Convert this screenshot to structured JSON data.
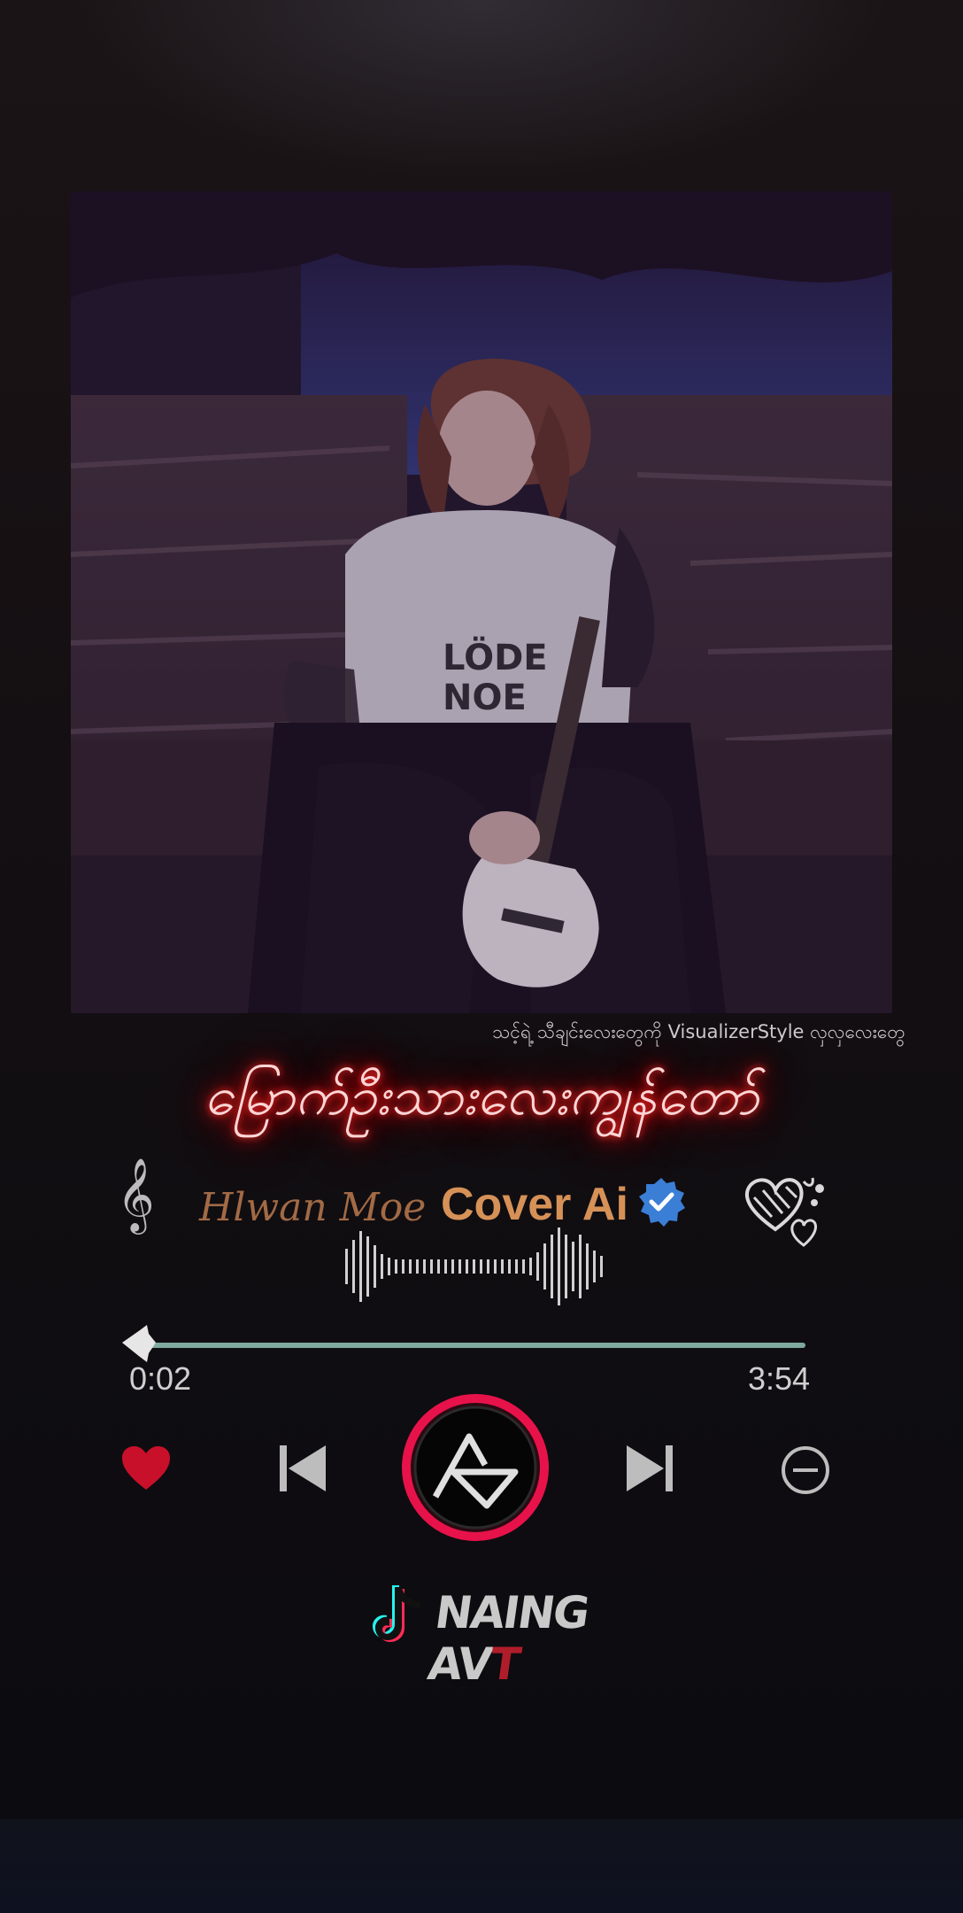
{
  "ticker_text": "သင့်ရဲ့ သီချင်းလေးတွေကို VisualizerStyle လှလှလေးတွေ",
  "song_title": "မြောက်ဦးသားလေးကျွန်တော်",
  "artist": {
    "name": "Hlwan Moe",
    "cover_label": "Cover Ai"
  },
  "progress": {
    "elapsed": "0:02",
    "total": "3:54",
    "fraction": 0.01
  },
  "brand": {
    "name_main": "NAING AV",
    "name_accent": "T"
  },
  "colors": {
    "accent_red": "#ff1e3c",
    "progress": "#7fa89f",
    "cover_label": "#d69157",
    "verified": "#3b7ed6"
  },
  "icons": {
    "clef": "treble-clef-icon",
    "verified": "verified-badge-icon",
    "hearts": "hearts-doodle-icon",
    "like": "heart-icon",
    "prev": "skip-previous-icon",
    "play": "play-pause-logo-icon",
    "next": "skip-next-icon",
    "minus": "minus-circle-icon",
    "tiktok": "tiktok-icon"
  }
}
